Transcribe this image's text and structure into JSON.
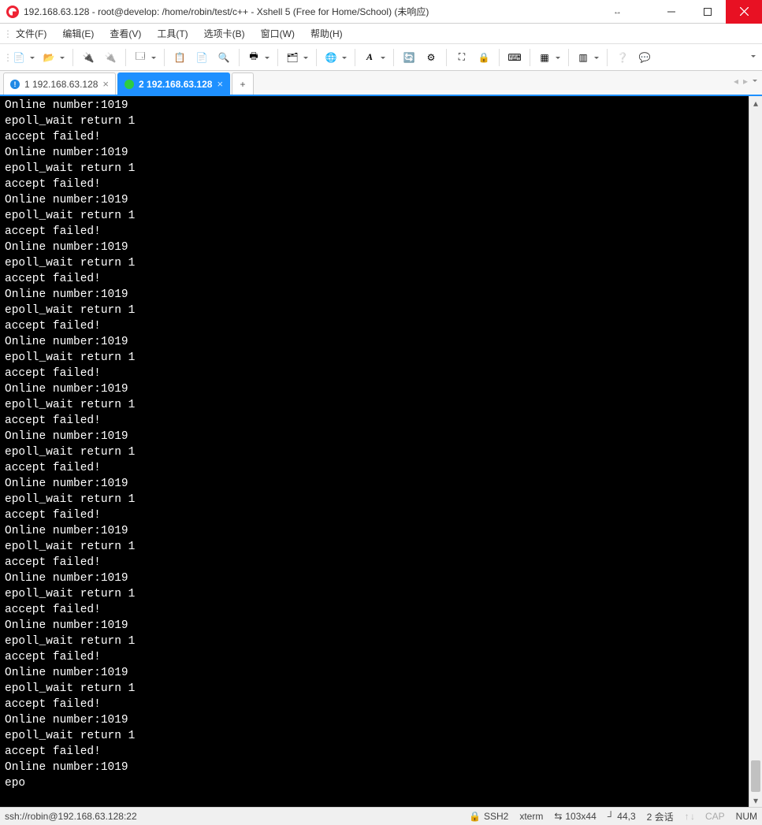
{
  "window": {
    "title": "192.168.63.128 - root@develop: /home/robin/test/c++ - Xshell 5 (Free for Home/School) (未响应)"
  },
  "menu": {
    "items": [
      {
        "label": "文件(F)"
      },
      {
        "label": "编辑(E)"
      },
      {
        "label": "查看(V)"
      },
      {
        "label": "工具(T)"
      },
      {
        "label": "选项卡(B)"
      },
      {
        "label": "窗口(W)"
      },
      {
        "label": "帮助(H)"
      }
    ]
  },
  "tabs": {
    "items": [
      {
        "indicator": "!",
        "label": "1 192.168.63.128",
        "active": false
      },
      {
        "indicator": "●",
        "label": "2 192.168.63.128",
        "active": true
      }
    ],
    "new_label": "+"
  },
  "terminal": {
    "lines": [
      "Online number:1019",
      "epoll_wait return 1",
      "accept failed!",
      "Online number:1019",
      "epoll_wait return 1",
      "accept failed!",
      "Online number:1019",
      "epoll_wait return 1",
      "accept failed!",
      "Online number:1019",
      "epoll_wait return 1",
      "accept failed!",
      "Online number:1019",
      "epoll_wait return 1",
      "accept failed!",
      "Online number:1019",
      "epoll_wait return 1",
      "accept failed!",
      "Online number:1019",
      "epoll_wait return 1",
      "accept failed!",
      "Online number:1019",
      "epoll_wait return 1",
      "accept failed!",
      "Online number:1019",
      "epoll_wait return 1",
      "accept failed!",
      "Online number:1019",
      "epoll_wait return 1",
      "accept failed!",
      "Online number:1019",
      "epoll_wait return 1",
      "accept failed!",
      "Online number:1019",
      "epoll_wait return 1",
      "accept failed!",
      "Online number:1019",
      "epoll_wait return 1",
      "accept failed!",
      "Online number:1019",
      "epoll_wait return 1",
      "accept failed!",
      "Online number:1019",
      "epo"
    ]
  },
  "status": {
    "connection": "ssh://robin@192.168.63.128:22",
    "protocol": "SSH2",
    "term_type": "xterm",
    "size": "103x44",
    "cursor": "44,3",
    "sessions": "2 会话",
    "cap": "CAP",
    "num": "NUM"
  },
  "icons": {
    "lock": "🔒",
    "size": "⇆",
    "pos": "┘"
  }
}
